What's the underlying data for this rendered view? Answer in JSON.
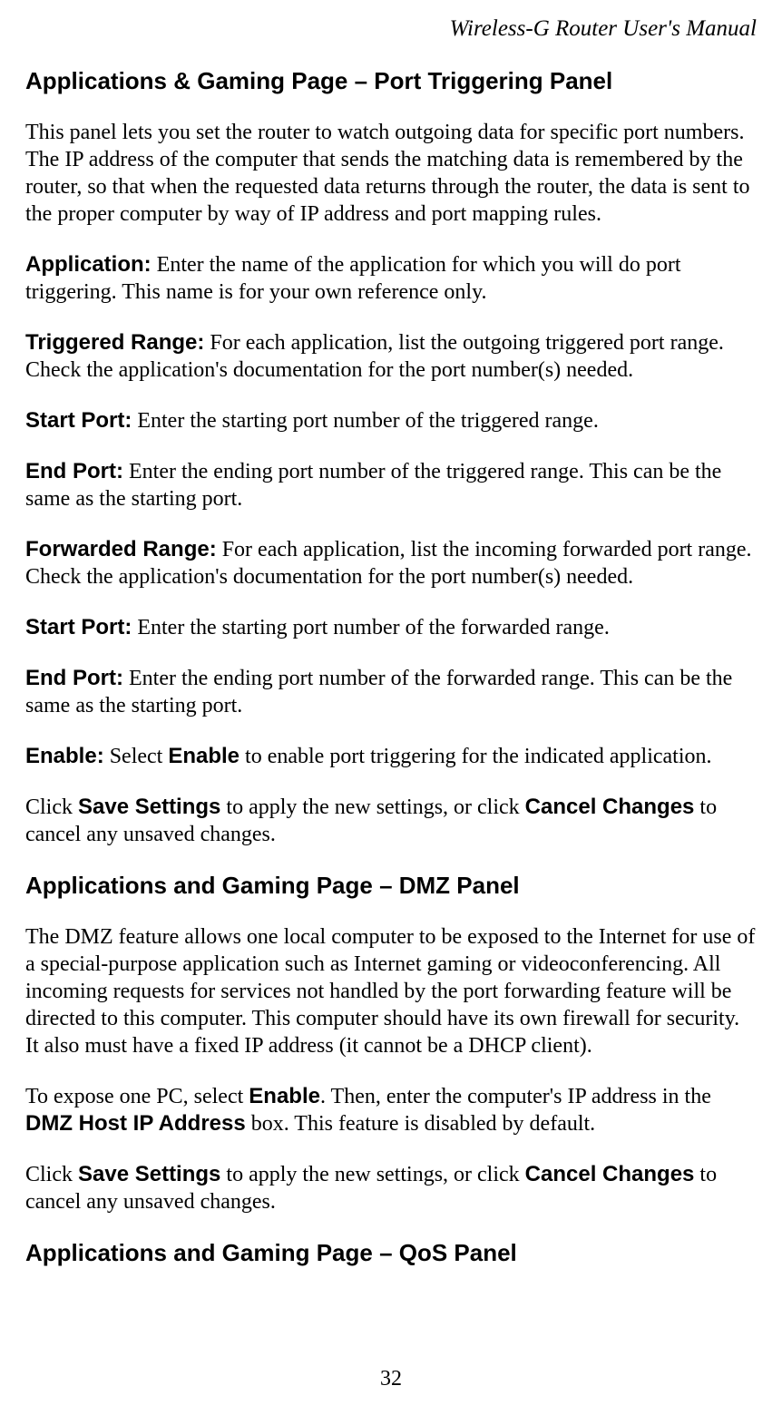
{
  "header": {
    "running_head": "Wireless-G Router User's Manual"
  },
  "section1": {
    "heading": "Applications & Gaming Page – Port Triggering Panel",
    "intro": "This panel lets you set the router to watch outgoing data for specific port numbers. The IP address of the computer that sends the matching data is remembered by the router, so that when the requested data returns through the router, the data is sent to the proper computer by way of IP address and port mapping rules.",
    "application_label": "Application:",
    "application_text": " Enter the name of the application for which you will do port triggering. This name is for your own reference only.",
    "triggered_label": "Triggered Range:",
    "triggered_text": " For each application, list the outgoing triggered port range. Check the application's documentation for the port number(s) needed.",
    "startport1_label": "Start Port:",
    "startport1_text": " Enter the starting port number of the triggered range.",
    "endport1_label": "End Port:",
    "endport1_text": " Enter the ending port number of the triggered range. This can be the same as the starting port.",
    "forwarded_label": "Forwarded Range:",
    "forwarded_text": " For each application, list the incoming forwarded port range. Check the application's documentation for the port number(s) needed.",
    "startport2_label": "Start Port:",
    "startport2_text": " Enter the starting port number of the forwarded range.",
    "endport2_label": "End Port:",
    "endport2_text": " Enter the ending port number of the forwarded range. This can be the same as the starting port.",
    "enable_label": "Enable:",
    "enable_pre": " Select ",
    "enable_bold": "Enable",
    "enable_post": " to enable port triggering for the indicated application.",
    "save_pre": "Click ",
    "save_bold1": "Save Settings",
    "save_mid": " to apply the new settings, or click ",
    "save_bold2": "Cancel Changes",
    "save_post": " to cancel any unsaved changes."
  },
  "section2": {
    "heading": "Applications and Gaming Page – DMZ Panel",
    "intro": "The DMZ feature allows one local computer to be exposed to the Internet for use of a special-purpose application such as Internet gaming or videoconferencing. All incoming requests for services not handled by the port forwarding feature will be directed to this computer. This computer should have its own firewall for security. It also must have a fixed IP address (it cannot be a DHCP client).",
    "expose_pre": "To expose one PC, select ",
    "expose_bold1": "Enable",
    "expose_mid": ". Then, enter the computer's IP address in the ",
    "expose_bold2": "DMZ Host IP Address",
    "expose_post": " box. This feature is disabled by default.",
    "save_pre": "Click ",
    "save_bold1": "Save Settings",
    "save_mid": " to apply the new settings, or click ",
    "save_bold2": "Cancel Changes",
    "save_post": " to cancel any unsaved changes."
  },
  "section3": {
    "heading": "Applications and Gaming Page – QoS Panel"
  },
  "footer": {
    "page_number": "32"
  }
}
